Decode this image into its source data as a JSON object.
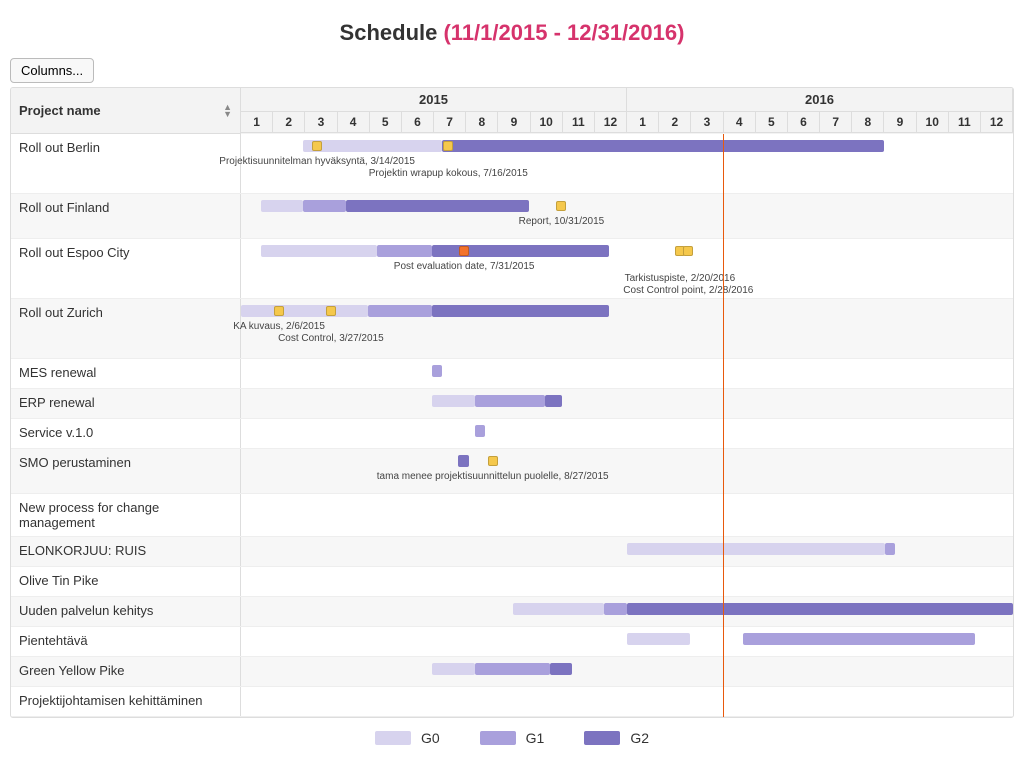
{
  "title_prefix": "Schedule ",
  "title_range": "(11/1/2015 - 12/31/2016)",
  "columns_button": "Columns...",
  "name_header": "Project name",
  "years": [
    {
      "label": "2015",
      "months": [
        "1",
        "2",
        "3",
        "4",
        "5",
        "6",
        "7",
        "8",
        "9",
        "10",
        "11",
        "12"
      ]
    },
    {
      "label": "2016",
      "months": [
        "1",
        "2",
        "3",
        "4",
        "5",
        "6",
        "7",
        "8",
        "9",
        "10",
        "11",
        "12"
      ]
    }
  ],
  "legend": {
    "g0": "G0",
    "g1": "G1",
    "g2": "G2"
  },
  "chart_data": {
    "type": "gantt",
    "x_range": {
      "start": "2015-01-01",
      "end": "2016-12-31"
    },
    "today": "2016-04-01",
    "phases": [
      "G0",
      "G1",
      "G2"
    ],
    "phase_colors": {
      "G0": "#d7d3ee",
      "G1": "#a9a0dc",
      "G2": "#7c73c0"
    },
    "projects": [
      {
        "name": "Roll out Berlin",
        "bars": [
          {
            "phase": "G0",
            "start": "2015-03-01",
            "end": "2015-07-10"
          },
          {
            "phase": "G2",
            "start": "2015-07-10",
            "end": "2016-08-31"
          }
        ],
        "milestones": [
          {
            "label": "Projektisuunnitelman hyväksyntä, 3/14/2015",
            "date": "2015-03-14",
            "color": "yellow"
          },
          {
            "label": "Projektin wrapup kokous, 7/16/2015",
            "date": "2015-07-16",
            "color": "yellow"
          }
        ],
        "height": 3
      },
      {
        "name": "Roll out Finland",
        "bars": [
          {
            "phase": "G0",
            "start": "2015-01-20",
            "end": "2015-03-01"
          },
          {
            "phase": "G1",
            "start": "2015-03-01",
            "end": "2015-04-10"
          },
          {
            "phase": "G2",
            "start": "2015-04-10",
            "end": "2015-09-30"
          }
        ],
        "milestones": [
          {
            "label": "Report, 10/31/2015",
            "date": "2015-10-31",
            "color": "yellow"
          }
        ],
        "height": 2
      },
      {
        "name": "Roll out Espoo City",
        "bars": [
          {
            "phase": "G0",
            "start": "2015-01-20",
            "end": "2015-05-10"
          },
          {
            "phase": "G1",
            "start": "2015-05-10",
            "end": "2015-07-01"
          },
          {
            "phase": "G2",
            "start": "2015-07-01",
            "end": "2015-12-15"
          }
        ],
        "milestones": [
          {
            "label": "Post evaluation date, 7/31/2015",
            "date": "2015-07-31",
            "color": "orange"
          },
          {
            "label": "Tarkistuspiste, 2/20/2016",
            "date": "2016-02-20",
            "color": "yellow"
          },
          {
            "label": "Cost Control point, 2/28/2016",
            "date": "2016-02-28",
            "color": "yellow"
          }
        ],
        "height": 3
      },
      {
        "name": "Roll out Zurich",
        "bars": [
          {
            "phase": "G0",
            "start": "2015-01-01",
            "end": "2015-05-01"
          },
          {
            "phase": "G1",
            "start": "2015-05-01",
            "end": "2015-07-01"
          },
          {
            "phase": "G2",
            "start": "2015-07-01",
            "end": "2015-12-15"
          }
        ],
        "milestones": [
          {
            "label": "KA kuvaus, 2/6/2015",
            "date": "2015-02-06",
            "color": "yellow"
          },
          {
            "label": "Cost Control, 3/27/2015",
            "date": "2015-03-27",
            "color": "yellow"
          }
        ],
        "height": 3
      },
      {
        "name": "MES renewal",
        "bars": [
          {
            "phase": "G1",
            "start": "2015-07-01",
            "end": "2015-07-10"
          }
        ],
        "milestones": [],
        "height": 1
      },
      {
        "name": "ERP renewal",
        "bars": [
          {
            "phase": "G0",
            "start": "2015-07-01",
            "end": "2015-08-10"
          },
          {
            "phase": "G1",
            "start": "2015-08-10",
            "end": "2015-10-15"
          },
          {
            "phase": "G2",
            "start": "2015-10-15",
            "end": "2015-11-01"
          }
        ],
        "milestones": [],
        "height": 1
      },
      {
        "name": "Service v.1.0",
        "bars": [
          {
            "phase": "G1",
            "start": "2015-08-10",
            "end": "2015-08-20"
          }
        ],
        "milestones": [],
        "height": 1
      },
      {
        "name": "SMO perustaminen",
        "bars": [
          {
            "phase": "G2",
            "start": "2015-07-25",
            "end": "2015-08-05"
          }
        ],
        "milestones": [
          {
            "label": "tama menee projektisuunnittelun puolelle, 8/27/2015",
            "date": "2015-08-27",
            "color": "yellow"
          }
        ],
        "height": 2
      },
      {
        "name": "New process for change management",
        "bars": [],
        "milestones": [],
        "height": 1
      },
      {
        "name": "ELONKORJUU: RUIS",
        "bars": [
          {
            "phase": "G0",
            "start": "2016-01-01",
            "end": "2016-09-01"
          },
          {
            "phase": "G1",
            "start": "2016-09-01",
            "end": "2016-09-10"
          }
        ],
        "milestones": [],
        "height": 1
      },
      {
        "name": "Olive Tin Pike",
        "bars": [],
        "milestones": [],
        "height": 1
      },
      {
        "name": "Uuden palvelun kehitys",
        "bars": [
          {
            "phase": "G0",
            "start": "2015-09-15",
            "end": "2015-12-10"
          },
          {
            "phase": "G1",
            "start": "2015-12-10",
            "end": "2016-01-01"
          },
          {
            "phase": "G2",
            "start": "2016-01-01",
            "end": "2016-12-31"
          }
        ],
        "milestones": [],
        "height": 1
      },
      {
        "name": "Pientehtävä",
        "bars": [
          {
            "phase": "G0",
            "start": "2016-01-01",
            "end": "2016-03-01"
          },
          {
            "phase": "G1",
            "start": "2016-04-20",
            "end": "2016-11-25"
          }
        ],
        "milestones": [],
        "height": 1
      },
      {
        "name": "Green Yellow Pike",
        "bars": [
          {
            "phase": "G0",
            "start": "2015-07-01",
            "end": "2015-08-10"
          },
          {
            "phase": "G1",
            "start": "2015-08-10",
            "end": "2015-10-20"
          },
          {
            "phase": "G2",
            "start": "2015-10-20",
            "end": "2015-11-10"
          }
        ],
        "milestones": [],
        "height": 1
      },
      {
        "name": "Projektijohtamisen kehittäminen",
        "bars": [],
        "milestones": [],
        "height": 1
      }
    ]
  }
}
